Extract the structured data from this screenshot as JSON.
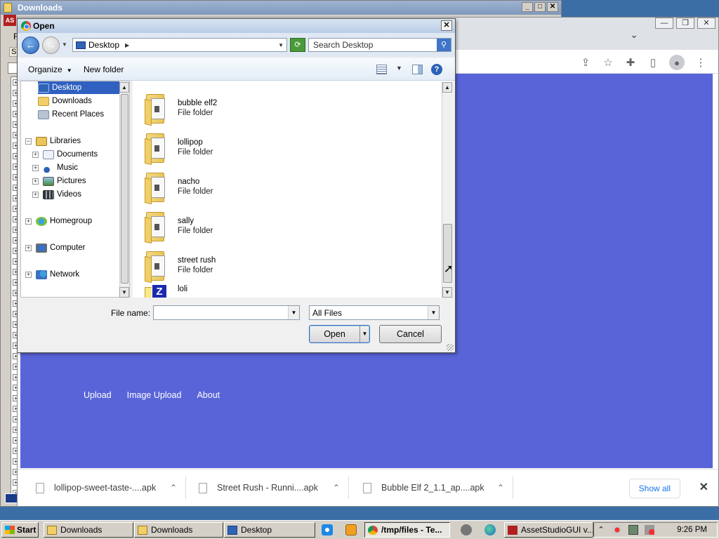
{
  "bg_window": {
    "title": "Downloads",
    "menu_letter": "F",
    "tab_letter": "Sc",
    "app_badge": "AS"
  },
  "browser": {
    "nav_links": [
      "Upload",
      "Image Upload",
      "About"
    ],
    "downloads": [
      {
        "name": "lollipop-sweet-taste-....apk"
      },
      {
        "name": "Street Rush - Runni....apk"
      },
      {
        "name": "Bubble Elf 2_1.1_ap....apk"
      }
    ],
    "show_all": "Show all",
    "colors": {
      "content_bg": "#5964d8",
      "link": "#1a73e8"
    }
  },
  "dialog": {
    "title": "Open",
    "address": "Desktop",
    "search_placeholder": "Search Desktop",
    "organize": "Organize",
    "new_folder": "New folder",
    "nav": {
      "desktop": "Desktop",
      "downloads": "Downloads",
      "recent_places": "Recent Places",
      "libraries": "Libraries",
      "documents": "Documents",
      "music": "Music",
      "pictures": "Pictures",
      "videos": "Videos",
      "homegroup": "Homegroup",
      "computer": "Computer",
      "network": "Network"
    },
    "files": [
      {
        "name": "bubble elf2",
        "type": "File folder"
      },
      {
        "name": "lollipop",
        "type": "File folder"
      },
      {
        "name": "nacho",
        "type": "File folder"
      },
      {
        "name": "sally",
        "type": "File folder"
      },
      {
        "name": "street rush",
        "type": "File folder"
      },
      {
        "name": "loli",
        "type": ""
      }
    ],
    "file_name_label": "File name:",
    "file_name_value": "",
    "file_type": "All Files",
    "open_label": "Open",
    "cancel_label": "Cancel"
  },
  "taskbar": {
    "start": "Start",
    "buttons": [
      "Downloads",
      "Downloads",
      "Desktop",
      "/tmp/files - Te...",
      "AssetStudioGUI v..."
    ],
    "clock": "9:26 PM"
  }
}
